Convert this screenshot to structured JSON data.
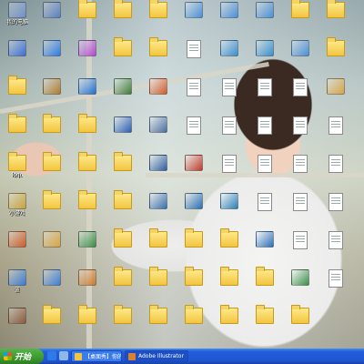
{
  "desktop": {
    "icons": [
      {
        "label": "我的电脑",
        "type": "app",
        "color": "#6f8fc9"
      },
      {
        "label": "",
        "type": "app",
        "color": "#3a6fd8"
      },
      {
        "label": "",
        "type": "folder"
      },
      {
        "label": "",
        "type": "folder"
      },
      {
        "label": "logo",
        "type": "folder"
      },
      {
        "label": "小游戏",
        "type": "app",
        "color": "#c9a23a"
      },
      {
        "label": "",
        "type": "app",
        "color": "#d15b2a"
      },
      {
        "label": "蓝",
        "type": "app",
        "color": "#3a7bd5"
      },
      {
        "label": "",
        "type": "app",
        "color": "#8d5a3a"
      },
      {
        "label": "",
        "type": "app",
        "color": "#5a7fbf"
      },
      {
        "label": "",
        "type": "app",
        "color": "#2f7ae5"
      },
      {
        "label": "",
        "type": "app",
        "color": "#b07a2a"
      },
      {
        "label": "",
        "type": "folder"
      },
      {
        "label": "",
        "type": "folder"
      },
      {
        "label": "",
        "type": "folder"
      },
      {
        "label": "",
        "type": "app",
        "color": "#d9a441"
      },
      {
        "label": "",
        "type": "app",
        "color": "#3c7fd9"
      },
      {
        "label": "",
        "type": "folder"
      },
      {
        "label": "",
        "type": "folder"
      },
      {
        "label": "",
        "type": "app",
        "color": "#b34ad1"
      },
      {
        "label": "",
        "type": "app",
        "color": "#1f6fd1"
      },
      {
        "label": "",
        "type": "folder"
      },
      {
        "label": "",
        "type": "folder"
      },
      {
        "label": "",
        "type": "folder"
      },
      {
        "label": "",
        "type": "app",
        "color": "#3a8f4a"
      },
      {
        "label": "",
        "type": "app",
        "color": "#ce7a2c"
      },
      {
        "label": "",
        "type": "folder"
      },
      {
        "label": "",
        "type": "folder"
      },
      {
        "label": "",
        "type": "folder"
      },
      {
        "label": "",
        "type": "app",
        "color": "#3f7d3a"
      },
      {
        "label": "",
        "type": "app",
        "color": "#2a5fb8"
      },
      {
        "label": "",
        "type": "folder"
      },
      {
        "label": "",
        "type": "folder"
      },
      {
        "label": "",
        "type": "folder"
      },
      {
        "label": "",
        "type": "folder"
      },
      {
        "label": "",
        "type": "folder"
      },
      {
        "label": "",
        "type": "folder"
      },
      {
        "label": "",
        "type": "folder"
      },
      {
        "label": "",
        "type": "app",
        "color": "#d35a2a"
      },
      {
        "label": "",
        "type": "app",
        "color": "#4a6f9f"
      },
      {
        "label": "",
        "type": "app",
        "color": "#2f5f9f"
      },
      {
        "label": "",
        "type": "app",
        "color": "#3a6fb0"
      },
      {
        "label": "",
        "type": "folder"
      },
      {
        "label": "",
        "type": "folder"
      },
      {
        "label": "",
        "type": "folder"
      },
      {
        "label": "",
        "type": "app",
        "color": "#4a90d9"
      },
      {
        "label": "",
        "type": "doc"
      },
      {
        "label": "",
        "type": "doc"
      },
      {
        "label": "",
        "type": "doc"
      },
      {
        "label": "",
        "type": "app",
        "color": "#c23a2a"
      },
      {
        "label": "",
        "type": "app",
        "color": "#2a6fb8"
      },
      {
        "label": "",
        "type": "folder"
      },
      {
        "label": "",
        "type": "folder"
      },
      {
        "label": "",
        "type": "folder"
      },
      {
        "label": "",
        "type": "app",
        "color": "#4a90d9"
      },
      {
        "label": "",
        "type": "app",
        "color": "#3a8fd0"
      },
      {
        "label": "",
        "type": "doc"
      },
      {
        "label": "",
        "type": "doc"
      },
      {
        "label": "",
        "type": "doc"
      },
      {
        "label": "",
        "type": "app",
        "color": "#2a7fb8"
      },
      {
        "label": "",
        "type": "folder"
      },
      {
        "label": "",
        "type": "folder"
      },
      {
        "label": "",
        "type": "folder"
      },
      {
        "label": "",
        "type": "app",
        "color": "#4a90d9"
      },
      {
        "label": "",
        "type": "app",
        "color": "#3a8fd0"
      },
      {
        "label": "",
        "type": "doc"
      },
      {
        "label": "",
        "type": "doc"
      },
      {
        "label": "",
        "type": "doc"
      },
      {
        "label": "",
        "type": "doc"
      },
      {
        "label": "",
        "type": "app",
        "color": "#2a6fb8"
      },
      {
        "label": "",
        "type": "folder"
      },
      {
        "label": "",
        "type": "folder"
      },
      {
        "label": "",
        "type": "folder"
      },
      {
        "label": "",
        "type": "app",
        "color": "#4a90d9"
      },
      {
        "label": "",
        "type": "doc"
      },
      {
        "label": "",
        "type": "doc"
      },
      {
        "label": "",
        "type": "doc"
      },
      {
        "label": "",
        "type": "doc"
      },
      {
        "label": "",
        "type": "doc"
      },
      {
        "label": "",
        "type": "app",
        "color": "#3a8f4a"
      },
      {
        "label": "",
        "type": "folder"
      },
      {
        "label": "",
        "type": "folder"
      },
      {
        "label": "",
        "type": "folder"
      },
      {
        "label": "",
        "type": "app",
        "color": "#d9a441"
      },
      {
        "label": "",
        "type": "doc"
      },
      {
        "label": "",
        "type": "doc"
      },
      {
        "label": "",
        "type": "doc"
      },
      {
        "label": "",
        "type": "doc"
      },
      {
        "label": "",
        "type": "doc"
      }
    ]
  },
  "taskbar": {
    "start_label": "开始",
    "quick_launch": [
      {
        "icon": "browser-icon",
        "color": "#2f7ae5"
      },
      {
        "icon": "desktop-icon",
        "color": "#8fb7e8"
      }
    ],
    "tasks": [
      {
        "label": "【桌面秀】你的桌",
        "icon": "folder-icon",
        "color": "#f2c540"
      },
      {
        "label": "Adobe Illustrator",
        "icon": "illustrator-icon",
        "color": "#d9822b"
      }
    ]
  }
}
